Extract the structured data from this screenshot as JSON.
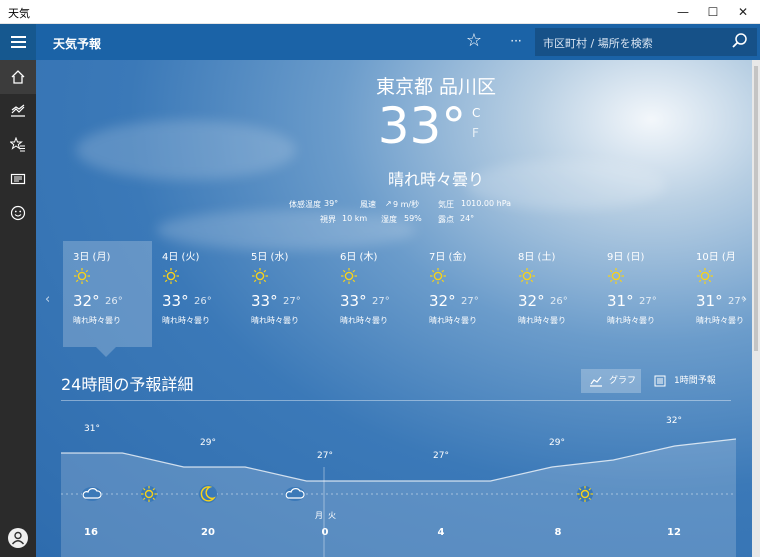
{
  "window": {
    "title": "天気",
    "minimize": "—",
    "maximize": "☐",
    "close": "✕"
  },
  "header": {
    "app_name": "天気予報",
    "more": "···",
    "search_placeholder": "市区町村 / 場所を検索"
  },
  "nav": {
    "items": [
      "home-icon",
      "chart-icon",
      "favorites-icon",
      "news-icon",
      "smiley-icon"
    ],
    "profile": "user-icon"
  },
  "current": {
    "location": "東京都 品川区",
    "temperature": "33°",
    "unit_c": "C",
    "unit_f": "F",
    "condition": "晴れ時々曇り",
    "details": {
      "feels_like_label": "体感温度",
      "feels_like": "39°",
      "wind_label": "風速",
      "wind": "9 m/秒",
      "pressure_label": "気圧",
      "pressure": "1010.00 hPa",
      "visibility_label": "視界",
      "visibility": "10 km",
      "humidity_label": "湿度",
      "humidity": "59%",
      "dewpoint_label": "露点",
      "dewpoint": "24°"
    }
  },
  "forecast": [
    {
      "day": "3日 (月)",
      "hi": "32°",
      "lo": "26°",
      "cond": "晴れ時々曇り"
    },
    {
      "day": "4日 (火)",
      "hi": "33°",
      "lo": "26°",
      "cond": "晴れ時々曇り"
    },
    {
      "day": "5日 (水)",
      "hi": "33°",
      "lo": "27°",
      "cond": "晴れ時々曇り"
    },
    {
      "day": "6日 (木)",
      "hi": "33°",
      "lo": "27°",
      "cond": "晴れ時々曇り"
    },
    {
      "day": "7日 (金)",
      "hi": "32°",
      "lo": "27°",
      "cond": "晴れ時々曇り"
    },
    {
      "day": "8日 (土)",
      "hi": "32°",
      "lo": "26°",
      "cond": "晴れ時々曇り"
    },
    {
      "day": "9日 (日)",
      "hi": "31°",
      "lo": "27°",
      "cond": "晴れ時々曇り"
    },
    {
      "day": "10日 (月",
      "hi": "31°",
      "lo": "27°",
      "cond": "晴れ時々曇り"
    }
  ],
  "hourly": {
    "title": "24時間の予報詳細",
    "graph_button": "グラフ",
    "hourly_button": "1時間予報",
    "day_labels": [
      "月",
      "火"
    ],
    "hour_labels": [
      "16",
      "20",
      "0",
      "4",
      "8",
      "12"
    ],
    "temp_labels": [
      "31°",
      "29°",
      "27°",
      "27°",
      "29°",
      "32°"
    ]
  },
  "chart_data": {
    "type": "area",
    "x": [
      "16",
      "18",
      "20",
      "22",
      "0",
      "2",
      "4",
      "6",
      "8",
      "10",
      "12",
      "14"
    ],
    "values": [
      31,
      31,
      29,
      29,
      27,
      27,
      27,
      27,
      29,
      30,
      32,
      33
    ],
    "icons": [
      "cloud",
      "sun",
      "moon",
      "cloud",
      "sun"
    ]
  }
}
